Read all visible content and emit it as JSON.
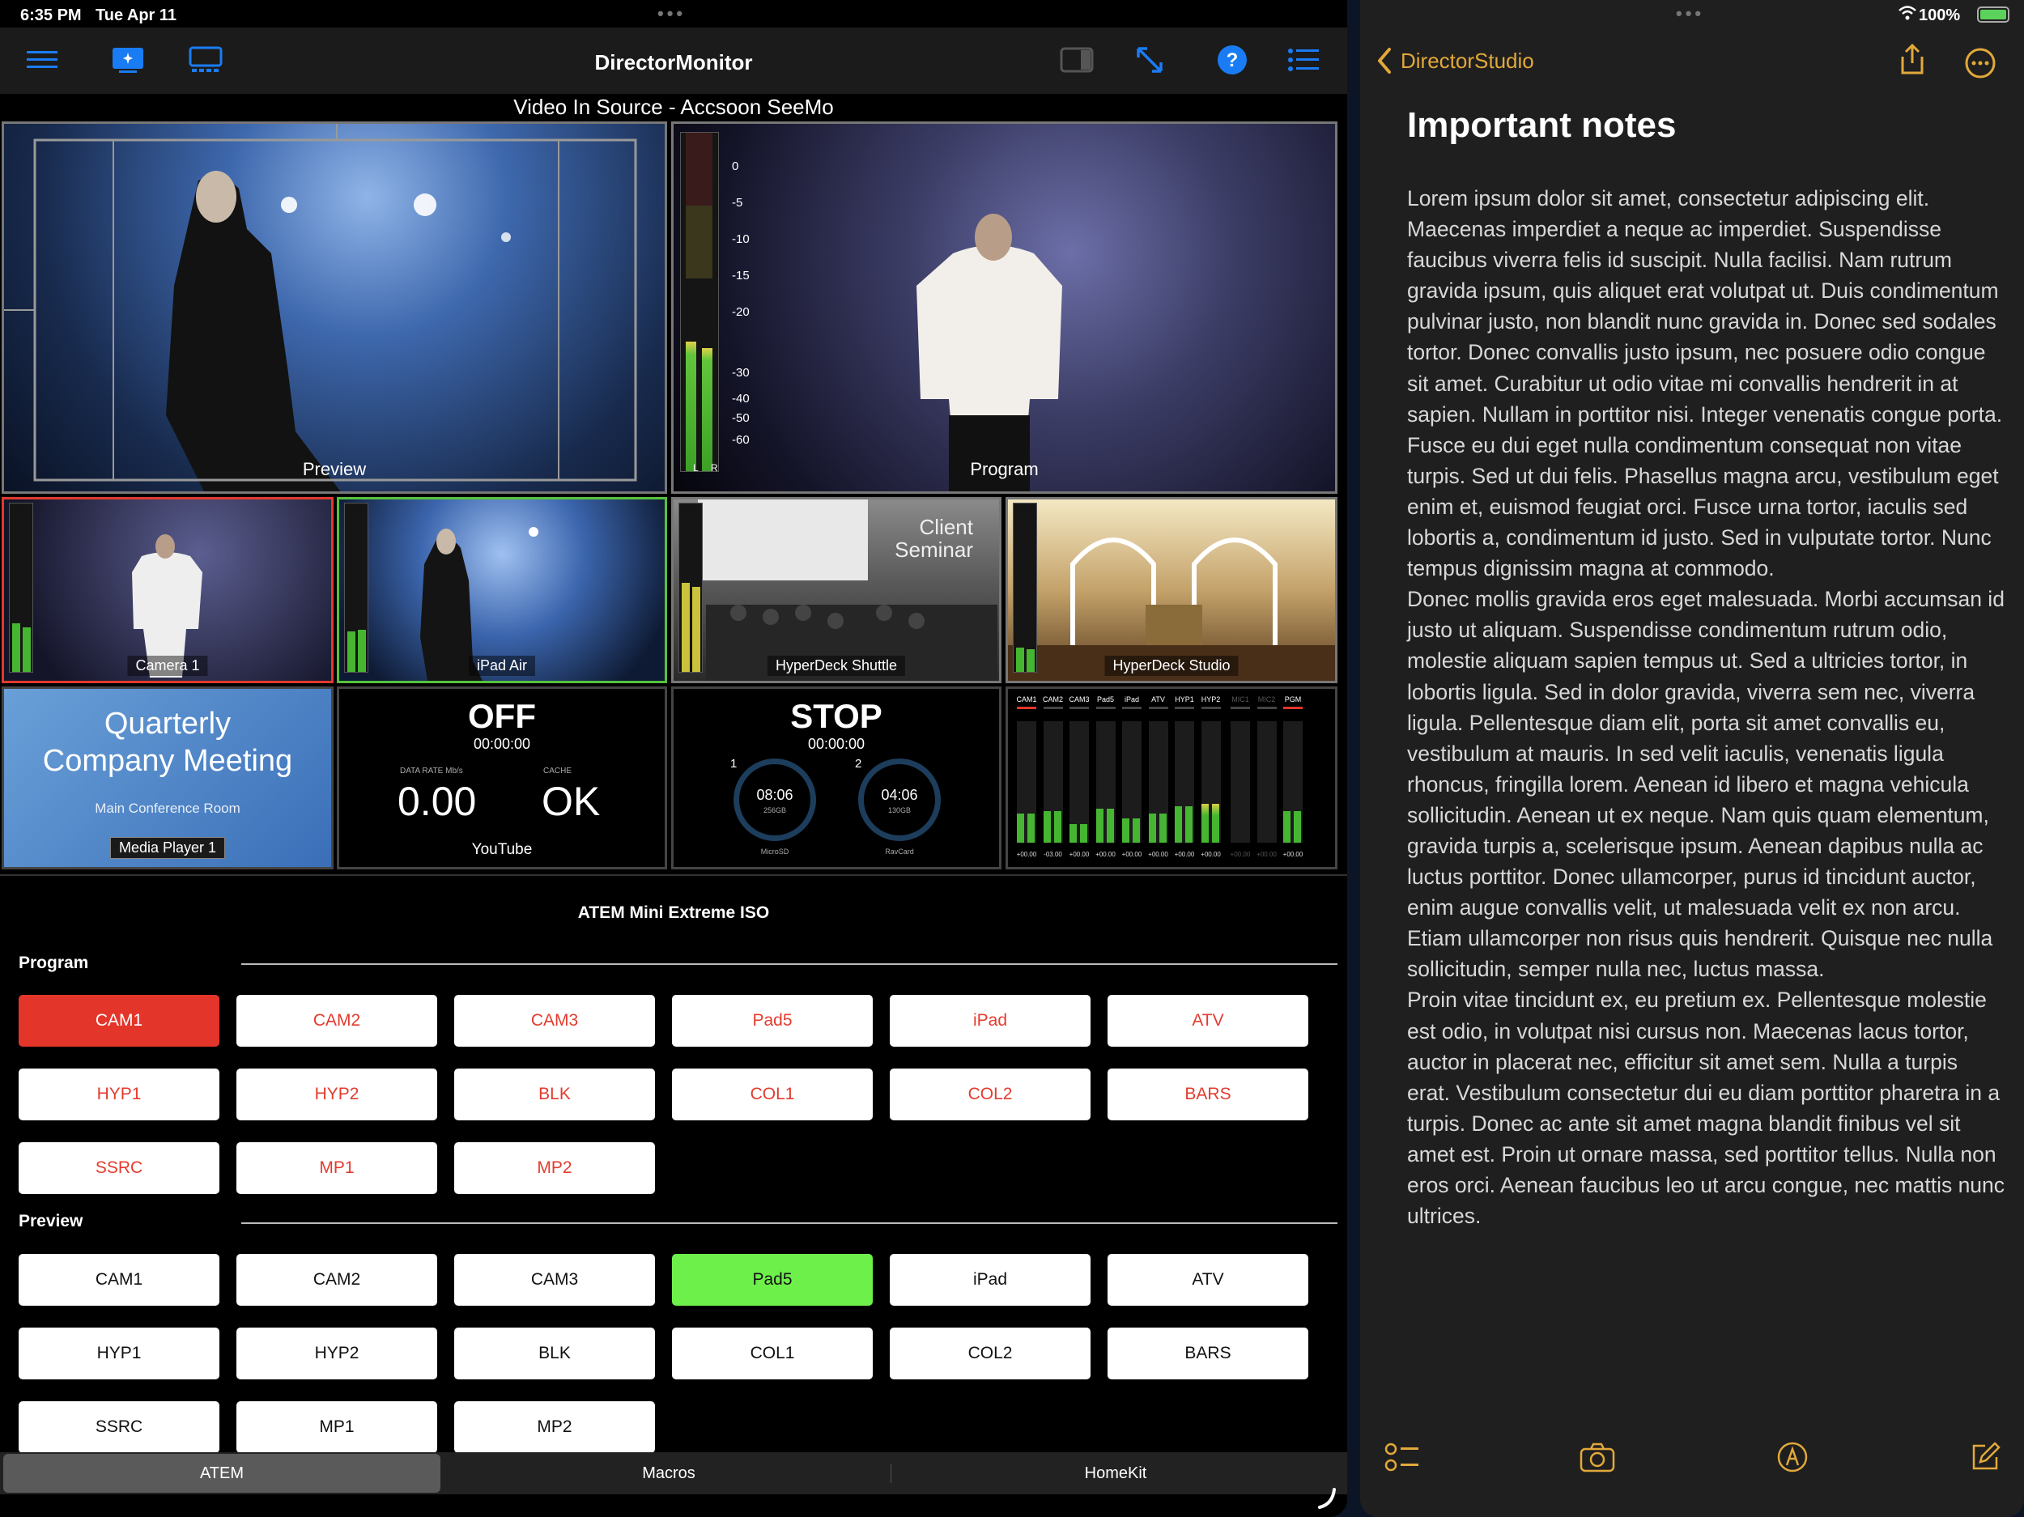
{
  "status": {
    "time": "6:35 PM",
    "date": "Tue Apr 11",
    "battery": "100%"
  },
  "app": {
    "title": "DirectorMonitor",
    "video_source": "Video In Source - Accsoon SeeMo",
    "multiview": {
      "preview_label": "Preview",
      "program_label": "Program",
      "meter_scale": [
        "0",
        "-5",
        "-10",
        "-15",
        "-20",
        "-30",
        "-40",
        "-50",
        "-60"
      ],
      "meter_lr": [
        "L",
        "R"
      ],
      "tiles": [
        "Camera 1",
        "iPad Air",
        "HyperDeck Shuttle",
        "HyperDeck Studio"
      ],
      "client_seminar": "Client Seminar",
      "media": {
        "title": "Quarterly Company Meeting",
        "subtitle": "Main Conference Room",
        "label": "Media Player 1"
      },
      "stream": {
        "status": "OFF",
        "timecode": "00:00:00",
        "rate_label": "DATA RATE Mb/s",
        "rate": "0.00",
        "cache_label": "CACHE",
        "cache": "OK",
        "service": "YouTube"
      },
      "record": {
        "status": "STOP",
        "timecode": "00:00:00",
        "disks": [
          {
            "num": "1",
            "time": "08:06",
            "size": "256GB",
            "media": "MicroSD"
          },
          {
            "num": "2",
            "time": "04:06",
            "size": "130GB",
            "media": "RavCard"
          }
        ]
      },
      "audio": {
        "channels": [
          "CAM1",
          "CAM2",
          "CAM3",
          "Pad5",
          "iPad",
          "ATV",
          "HYP1",
          "HYP2",
          "MIC1",
          "MIC2",
          "PGM"
        ],
        "values": [
          "+00.00",
          "-03.00",
          "+00.00",
          "+00.00",
          "+00.00",
          "+00.00",
          "+00.00",
          "+00.00",
          "+00.00",
          "+00.00",
          "+00.00"
        ],
        "levels": [
          0.24,
          0.26,
          0.15,
          0.28,
          0.2,
          0.24,
          0.3,
          0.32,
          0.0,
          0.0,
          0.26
        ]
      }
    },
    "switcher": {
      "title": "ATEM Mini Extreme ISO",
      "program_label": "Program",
      "preview_label": "Preview",
      "program_buttons": [
        "CAM1",
        "CAM2",
        "CAM3",
        "Pad5",
        "iPad",
        "ATV",
        "HYP1",
        "HYP2",
        "BLK",
        "COL1",
        "COL2",
        "BARS",
        "SSRC",
        "MP1",
        "MP2"
      ],
      "program_selected": "CAM1",
      "preview_buttons": [
        "CAM1",
        "CAM2",
        "CAM3",
        "Pad5",
        "iPad",
        "ATV",
        "HYP1",
        "HYP2",
        "BLK",
        "COL1",
        "COL2",
        "BARS",
        "SSRC",
        "MP1",
        "MP2"
      ],
      "preview_selected": "Pad5"
    },
    "tabs": [
      "ATEM",
      "Macros",
      "HomeKit"
    ],
    "active_tab": "ATEM"
  },
  "notes": {
    "back_label": "DirectorStudio",
    "title": "Important notes",
    "paragraphs": [
      "Lorem ipsum dolor sit amet, consectetur adipiscing elit. Maecenas imperdiet a neque ac imperdiet. Suspendisse faucibus viverra felis id suscipit. Nulla facilisi. Nam rutrum gravida ipsum, quis aliquet erat volutpat ut. Duis condimentum pulvinar justo, non blandit nunc gravida in. Donec sed sodales tortor. Donec convallis justo ipsum, nec posuere odio congue sit amet. Curabitur ut odio vitae mi convallis hendrerit in at sapien. Nullam in porttitor nisi. Integer venenatis congue porta. Fusce eu dui eget nulla condimentum consequat non vitae turpis. Sed ut dui felis. Phasellus magna arcu, vestibulum eget enim et, euismod feugiat orci. Fusce urna tortor, iaculis sed lobortis a, condimentum id justo. Sed in vulputate tortor. Nunc tempus dignissim magna at commodo.",
      "Donec mollis gravida eros eget malesuada. Morbi accumsan id justo ut aliquam. Suspendisse condimentum rutrum odio, molestie aliquam sapien tempus ut. Sed a ultricies tortor, in lobortis ligula. Sed in dolor gravida, viverra sem nec, viverra ligula. Pellentesque diam elit, porta sit amet convallis eu, vestibulum at mauris. In sed velit iaculis, venenatis ligula rhoncus, fringilla lorem. Aenean id libero et magna vehicula sollicitudin. Aenean ut ex neque. Nam quis quam elementum, gravida turpis a, scelerisque ipsum. Aenean dapibus nulla ac luctus porttitor. Donec ullamcorper, purus id tincidunt auctor, enim augue convallis velit, ut malesuada velit ex non arcu. Etiam ullamcorper non risus quis hendrerit. Quisque nec nulla sollicitudin, semper nulla nec, luctus massa.",
      "Proin vitae tincidunt ex, eu pretium ex. Pellentesque molestie est odio, in volutpat nisi cursus non. Maecenas lacus tortor, auctor in placerat nec, efficitur sit amet sem. Nulla a turpis erat. Vestibulum consectetur dui eu diam porttitor pharetra in a turpis. Donec ac ante sit amet magna blandit finibus vel sit amet est. Proin ut ornare massa, sed porttitor tellus. Nulla non eros orci. Aenean faucibus leo ut arcu congue, nec mattis nunc ultrices."
    ]
  },
  "colors": {
    "program_red": "#e4352a",
    "preview_green": "#6ef04a",
    "accent_blue": "#1a7cf5",
    "notes_yellow": "#e2a93a"
  },
  "icons": [
    "menu-icon",
    "multiview-icon",
    "monitor-icon",
    "sidebar-icon",
    "expand-icon",
    "help-icon",
    "list-icon",
    "chevron-left-icon",
    "share-icon",
    "more-icon",
    "checklist-icon",
    "camera-icon",
    "markup-icon",
    "compose-icon",
    "wifi-icon",
    "battery-icon"
  ]
}
